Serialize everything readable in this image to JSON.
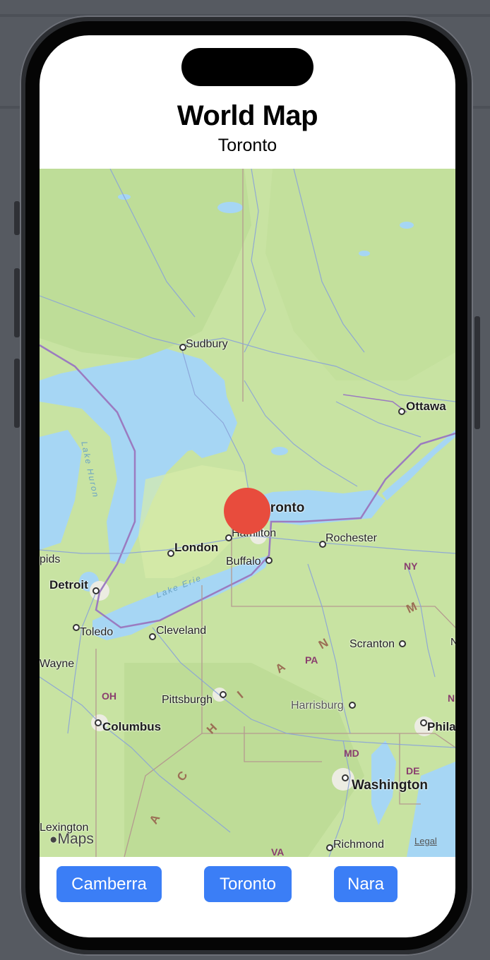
{
  "header": {
    "title": "World Map",
    "subtitle": "Toronto"
  },
  "map": {
    "attribution": "Maps",
    "legal": "Legal",
    "labels": {
      "sudbury": "Sudbury",
      "ottawa": "Ottawa",
      "toronto": "Toronto",
      "hamilton": "Hamilton",
      "london": "London",
      "rochester": "Rochester",
      "buffalo": "Buffalo",
      "detroit": "Detroit",
      "rapids": "pids",
      "toledo": "Toledo",
      "cleveland": "Cleveland",
      "scranton": "Scranton",
      "wayne": "Wayne",
      "pittsburgh": "Pittsburgh",
      "harrisburg": "Harrisburg",
      "columbus": "Columbus",
      "phila": "Phila",
      "washington": "Washington",
      "lexington": "Lexington",
      "richmond": "Richmond",
      "lake_huron": "Lake Huron",
      "lake_erie": "Lake Erie",
      "ny": "NY",
      "pa": "PA",
      "oh": "OH",
      "md": "MD",
      "de": "DE",
      "va": "VA",
      "n_edge": "N",
      "n_edge2": "N"
    },
    "range_letters": [
      "M",
      "N",
      "A",
      "I",
      "H",
      "C",
      "A"
    ],
    "selected_marker": "Toronto"
  },
  "buttons": {
    "camberra": "Camberra",
    "toronto": "Toronto",
    "nara": "Nara"
  },
  "colors": {
    "marker": "#e84c3d",
    "button": "#3b7ef6",
    "water": "#a6d6f4",
    "land": "#c8e3a2"
  }
}
